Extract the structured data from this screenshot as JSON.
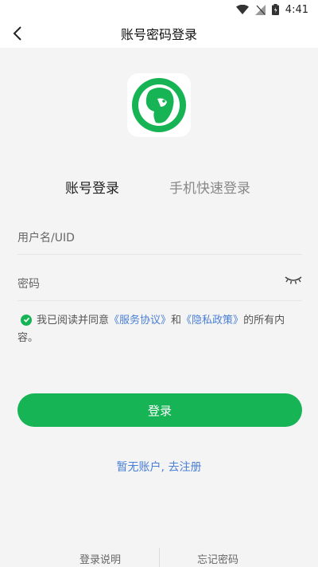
{
  "status_bar": {
    "time": "4:41",
    "icons": [
      "wifi-icon",
      "signal-icon",
      "battery-icon"
    ]
  },
  "header": {
    "title": "账号密码登录",
    "back_icon": "chevron-left-icon"
  },
  "logo": {
    "icon": "lion-logo-icon",
    "color": "#17b456"
  },
  "tabs": [
    {
      "label": "账号登录",
      "active": true
    },
    {
      "label": "手机快速登录",
      "active": false
    }
  ],
  "form": {
    "username_placeholder": "用户名/UID",
    "password_placeholder": "密码",
    "password_toggle_icon": "eye-closed-icon"
  },
  "agreement": {
    "checked": true,
    "prefix": "我已阅读并同意",
    "service_link": "《服务协议》",
    "and": "和",
    "privacy_link": "《隐私政策》",
    "suffix": "的所有内容。"
  },
  "login_button": "登录",
  "register_link": "暂无账户, 去注册",
  "footer": {
    "left": "登录说明",
    "right": "忘记密码"
  },
  "colors": {
    "primary": "#17b456",
    "link": "#4a7fd6",
    "background": "#f4f4f4"
  }
}
